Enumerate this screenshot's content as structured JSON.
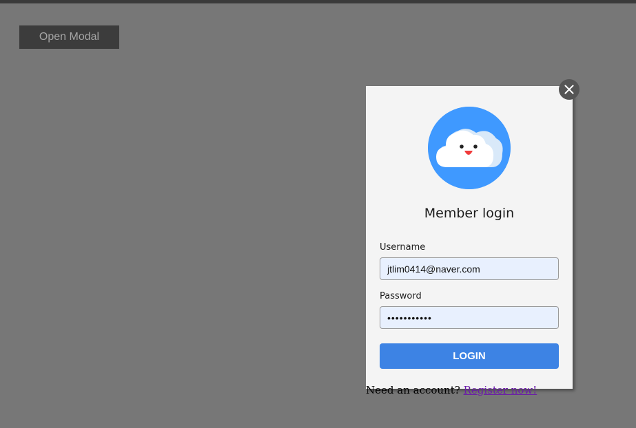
{
  "page": {
    "open_modal_label": "Open Modal"
  },
  "modal": {
    "title": "Member login",
    "username_label": "Username",
    "username_value": "jtlim0414@naver.com",
    "password_label": "Password",
    "password_value": "secretpassw",
    "login_label": "LOGIN",
    "register_prompt": "Need an account?",
    "register_link": "Register now!",
    "avatar_icon": "cloud-face-icon",
    "close_icon": "close-icon"
  },
  "colors": {
    "accent": "#3d83e4",
    "avatar_bg": "#3f99ff",
    "page_bg": "#777777",
    "modal_bg": "#f4f4f4",
    "link": "#6a1aa8"
  }
}
